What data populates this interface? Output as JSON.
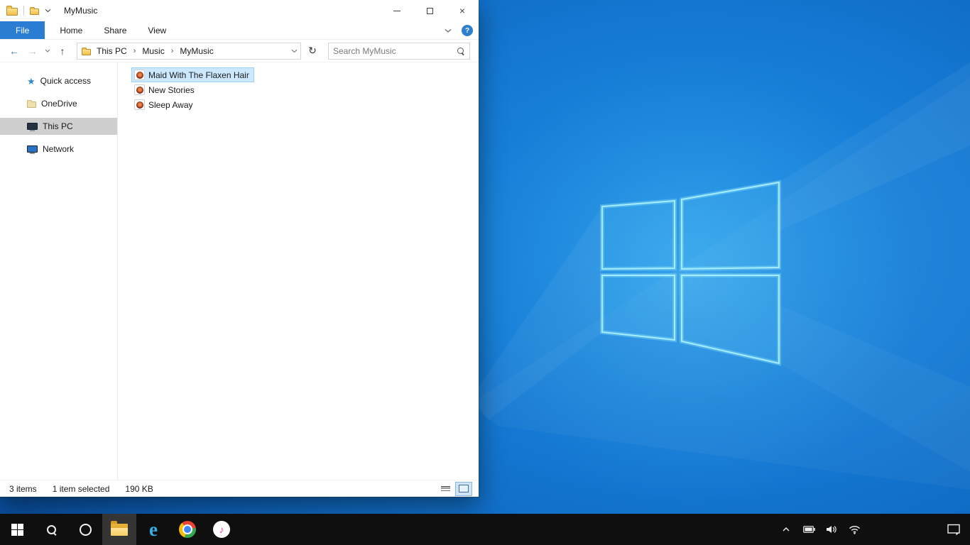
{
  "explorer": {
    "title": "MyMusic",
    "tabs": {
      "file": "File",
      "home": "Home",
      "share": "Share",
      "view": "View"
    },
    "help_glyph": "?",
    "nav": {
      "breadcrumb": [
        "This PC",
        "Music",
        "MyMusic"
      ],
      "separator": "›",
      "search_placeholder": "Search MyMusic"
    },
    "sidebar": {
      "items": [
        {
          "label": "Quick access",
          "icon": "quick-access-star",
          "selected": false
        },
        {
          "label": "OneDrive",
          "icon": "onedrive-folder",
          "selected": false
        },
        {
          "label": "This PC",
          "icon": "this-pc-monitor",
          "selected": true
        },
        {
          "label": "Network",
          "icon": "network-monitor",
          "selected": false
        }
      ]
    },
    "files": [
      {
        "name": "Maid With The Flaxen Hair",
        "icon": "media-file",
        "selected": true
      },
      {
        "name": "New Stories",
        "icon": "media-file",
        "selected": false
      },
      {
        "name": "Sleep Away",
        "icon": "media-file",
        "selected": false
      }
    ],
    "status": {
      "count": "3 items",
      "selection": "1 item selected",
      "size": "190 KB"
    }
  },
  "icons": {
    "back": "←",
    "forward": "→",
    "up": "↑",
    "refresh": "↻",
    "close": "×",
    "itunes_note": "♪",
    "quick_access_star": "★",
    "internet_explorer_e": "e"
  },
  "taskbar": {
    "buttons": [
      "start",
      "search",
      "cortana",
      "file-explorer",
      "internet-explorer",
      "chrome",
      "itunes"
    ],
    "tray": [
      "tray-expand",
      "battery",
      "volume",
      "network",
      "action-center"
    ]
  },
  "colors": {
    "file_tab_blue": "#2b7cd3",
    "selection_bg": "#cce8ff",
    "selection_border": "#99d1ff",
    "sidebar_selected_bg": "#cfcfcf",
    "wallpaper_base": "#1478d2",
    "taskbar_bg": "#0f0f0f"
  }
}
